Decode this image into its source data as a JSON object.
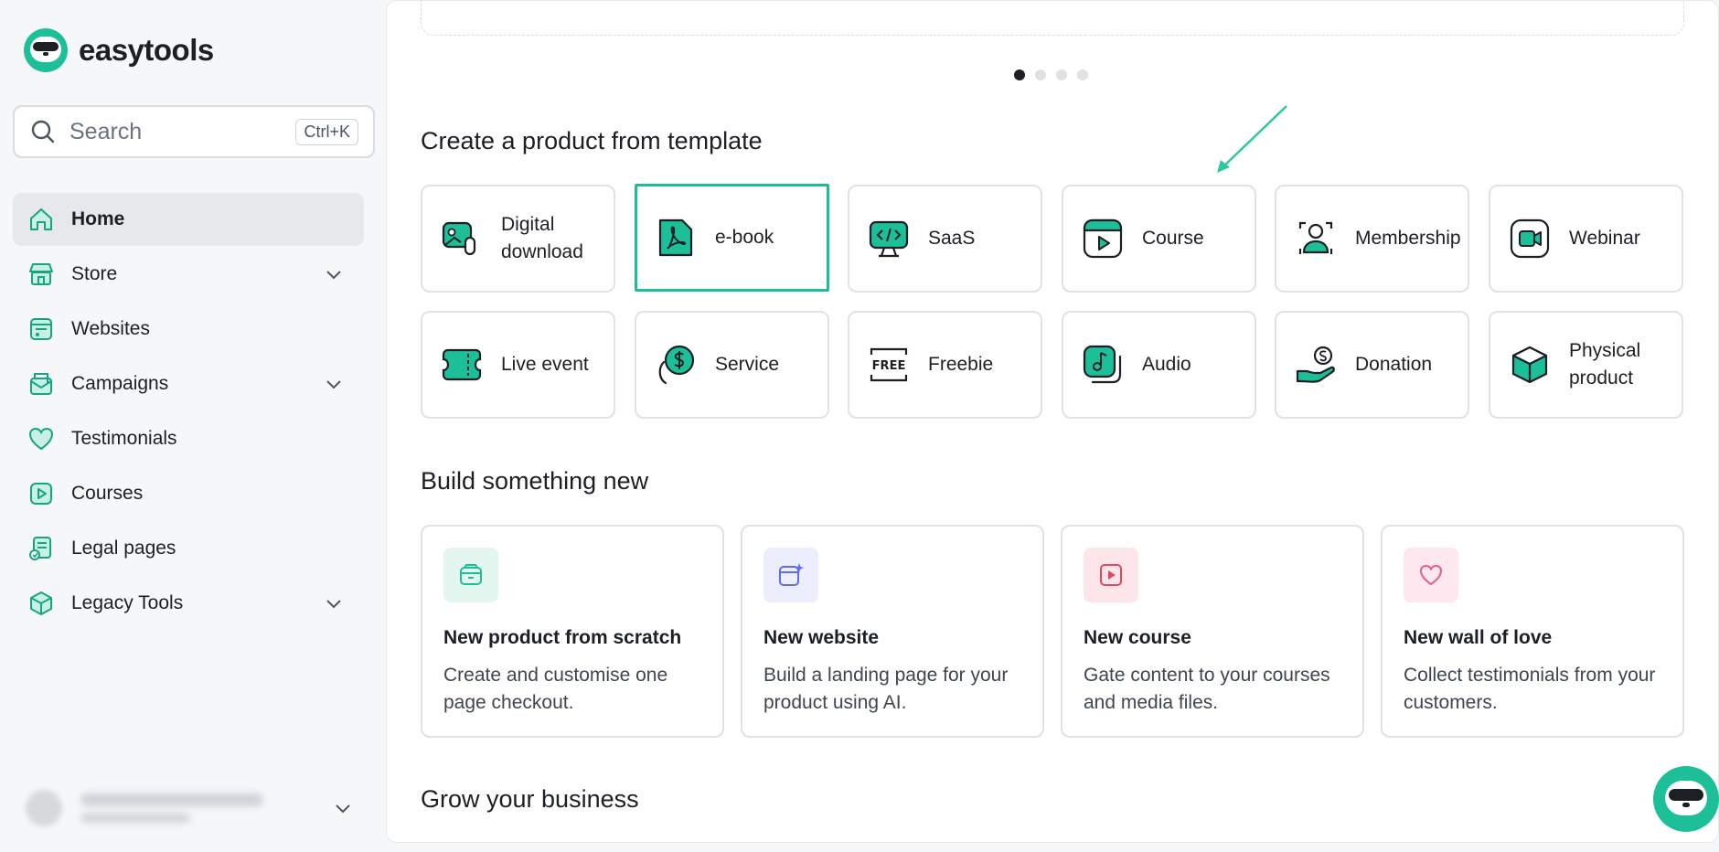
{
  "brand": {
    "name": "easytools"
  },
  "search": {
    "placeholder": "Search",
    "shortcut": "Ctrl+K"
  },
  "sidebar": {
    "items": [
      {
        "label": "Home",
        "icon": "home-icon",
        "active": true,
        "expandable": false
      },
      {
        "label": "Store",
        "icon": "store-icon",
        "active": false,
        "expandable": true
      },
      {
        "label": "Websites",
        "icon": "websites-icon",
        "active": false,
        "expandable": false
      },
      {
        "label": "Campaigns",
        "icon": "campaigns-icon",
        "active": false,
        "expandable": true
      },
      {
        "label": "Testimonials",
        "icon": "heart-icon",
        "active": false,
        "expandable": false
      },
      {
        "label": "Courses",
        "icon": "play-icon",
        "active": false,
        "expandable": false
      },
      {
        "label": "Legal pages",
        "icon": "legal-pages-icon",
        "active": false,
        "expandable": false
      },
      {
        "label": "Legacy Tools",
        "icon": "box-icon",
        "active": false,
        "expandable": true
      }
    ]
  },
  "carousel": {
    "pages": 4,
    "active_index": 0
  },
  "templates": {
    "title": "Create a product from template",
    "items": [
      {
        "label": "Digital download",
        "icon": "digital-download-icon",
        "selected": false
      },
      {
        "label": "e-book",
        "icon": "pdf-icon",
        "selected": true
      },
      {
        "label": "SaaS",
        "icon": "saas-icon",
        "selected": false
      },
      {
        "label": "Course",
        "icon": "course-icon",
        "selected": false
      },
      {
        "label": "Membership",
        "icon": "membership-icon",
        "selected": false
      },
      {
        "label": "Webinar",
        "icon": "webinar-icon",
        "selected": false
      },
      {
        "label": "Live event",
        "icon": "ticket-icon",
        "selected": false
      },
      {
        "label": "Service",
        "icon": "service-icon",
        "selected": false
      },
      {
        "label": "Freebie",
        "icon": "free-icon",
        "selected": false
      },
      {
        "label": "Audio",
        "icon": "audio-icon",
        "selected": false
      },
      {
        "label": "Donation",
        "icon": "donation-icon",
        "selected": false
      },
      {
        "label": "Physical product",
        "icon": "physical-product-icon",
        "selected": false
      }
    ]
  },
  "build": {
    "title": "Build something new",
    "items": [
      {
        "title": "New product from scratch",
        "desc": "Create and customise one page checkout.",
        "icon": "package-icon",
        "bg": "#e3f6f0",
        "fg": "#1cbf98"
      },
      {
        "title": "New website",
        "desc": "Build a landing page for your product using AI.",
        "icon": "ai-website-icon",
        "bg": "#eceefd",
        "fg": "#5b6cf0"
      },
      {
        "title": "New course",
        "desc": "Gate content to your courses and media files.",
        "icon": "video-icon",
        "bg": "#fde6ea",
        "fg": "#e5485d"
      },
      {
        "title": "New wall of love",
        "desc": "Collect testimonials from your customers.",
        "icon": "heart-icon",
        "bg": "#fde8ef",
        "fg": "#ec5a8c"
      }
    ]
  },
  "grow": {
    "title": "Grow your business"
  },
  "colors": {
    "accent": "#1cbf98",
    "dark": "#1c1f24",
    "border": "#dfe2e6"
  }
}
